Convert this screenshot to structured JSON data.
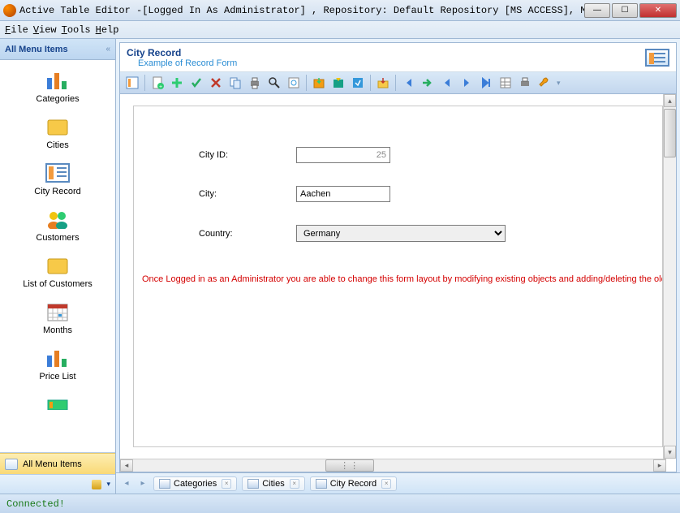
{
  "window": {
    "title": "Active Table Editor -[Logged In As Administrator] , Repository: Default Repository [MS ACCESS], MS Access, C:\\Doc..."
  },
  "menu": {
    "file": "File",
    "view": "View",
    "tools": "Tools",
    "help": "Help"
  },
  "sidebar": {
    "header": "All Menu Items",
    "items": [
      {
        "label": "Categories"
      },
      {
        "label": "Cities"
      },
      {
        "label": "City Record"
      },
      {
        "label": "Customers"
      },
      {
        "label": "List of Customers"
      },
      {
        "label": "Months"
      },
      {
        "label": "Price List"
      }
    ],
    "footer_label": "All Menu Items"
  },
  "record": {
    "title": "City Record",
    "subtitle": "Example of Record Form",
    "city_id_label": "City ID:",
    "city_id_value": "25",
    "city_label": "City:",
    "city_value": "Aachen",
    "country_label": "Country:",
    "country_value": "Germany",
    "admin_note": "Once Logged in as an Administrator you are able to change this form layout by modifying existing objects and adding/deleting the old or"
  },
  "toolbar": {
    "icons": [
      "form",
      "new",
      "add",
      "ok",
      "cancel",
      "copy",
      "print",
      "find",
      "preview",
      "export1",
      "export2",
      "export3",
      "import",
      "first",
      "next-green",
      "prev",
      "play",
      "last",
      "grid",
      "printer",
      "tool"
    ]
  },
  "tabs": [
    {
      "label": "Categories"
    },
    {
      "label": "Cities"
    },
    {
      "label": "City Record"
    }
  ],
  "status": "Connected!"
}
